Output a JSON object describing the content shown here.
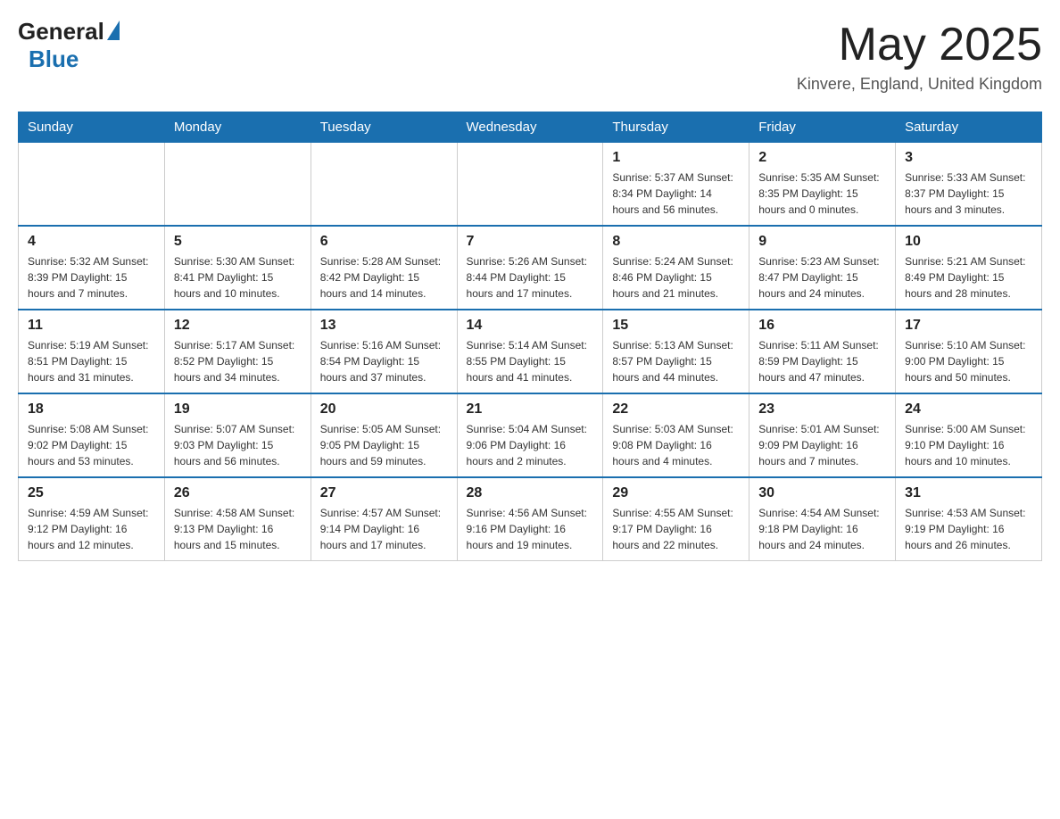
{
  "header": {
    "logo_general": "General",
    "logo_blue": "Blue",
    "month_title": "May 2025",
    "location": "Kinvere, England, United Kingdom"
  },
  "days_of_week": [
    "Sunday",
    "Monday",
    "Tuesday",
    "Wednesday",
    "Thursday",
    "Friday",
    "Saturday"
  ],
  "weeks": [
    [
      {
        "day": "",
        "info": ""
      },
      {
        "day": "",
        "info": ""
      },
      {
        "day": "",
        "info": ""
      },
      {
        "day": "",
        "info": ""
      },
      {
        "day": "1",
        "info": "Sunrise: 5:37 AM\nSunset: 8:34 PM\nDaylight: 14 hours\nand 56 minutes."
      },
      {
        "day": "2",
        "info": "Sunrise: 5:35 AM\nSunset: 8:35 PM\nDaylight: 15 hours\nand 0 minutes."
      },
      {
        "day": "3",
        "info": "Sunrise: 5:33 AM\nSunset: 8:37 PM\nDaylight: 15 hours\nand 3 minutes."
      }
    ],
    [
      {
        "day": "4",
        "info": "Sunrise: 5:32 AM\nSunset: 8:39 PM\nDaylight: 15 hours\nand 7 minutes."
      },
      {
        "day": "5",
        "info": "Sunrise: 5:30 AM\nSunset: 8:41 PM\nDaylight: 15 hours\nand 10 minutes."
      },
      {
        "day": "6",
        "info": "Sunrise: 5:28 AM\nSunset: 8:42 PM\nDaylight: 15 hours\nand 14 minutes."
      },
      {
        "day": "7",
        "info": "Sunrise: 5:26 AM\nSunset: 8:44 PM\nDaylight: 15 hours\nand 17 minutes."
      },
      {
        "day": "8",
        "info": "Sunrise: 5:24 AM\nSunset: 8:46 PM\nDaylight: 15 hours\nand 21 minutes."
      },
      {
        "day": "9",
        "info": "Sunrise: 5:23 AM\nSunset: 8:47 PM\nDaylight: 15 hours\nand 24 minutes."
      },
      {
        "day": "10",
        "info": "Sunrise: 5:21 AM\nSunset: 8:49 PM\nDaylight: 15 hours\nand 28 minutes."
      }
    ],
    [
      {
        "day": "11",
        "info": "Sunrise: 5:19 AM\nSunset: 8:51 PM\nDaylight: 15 hours\nand 31 minutes."
      },
      {
        "day": "12",
        "info": "Sunrise: 5:17 AM\nSunset: 8:52 PM\nDaylight: 15 hours\nand 34 minutes."
      },
      {
        "day": "13",
        "info": "Sunrise: 5:16 AM\nSunset: 8:54 PM\nDaylight: 15 hours\nand 37 minutes."
      },
      {
        "day": "14",
        "info": "Sunrise: 5:14 AM\nSunset: 8:55 PM\nDaylight: 15 hours\nand 41 minutes."
      },
      {
        "day": "15",
        "info": "Sunrise: 5:13 AM\nSunset: 8:57 PM\nDaylight: 15 hours\nand 44 minutes."
      },
      {
        "day": "16",
        "info": "Sunrise: 5:11 AM\nSunset: 8:59 PM\nDaylight: 15 hours\nand 47 minutes."
      },
      {
        "day": "17",
        "info": "Sunrise: 5:10 AM\nSunset: 9:00 PM\nDaylight: 15 hours\nand 50 minutes."
      }
    ],
    [
      {
        "day": "18",
        "info": "Sunrise: 5:08 AM\nSunset: 9:02 PM\nDaylight: 15 hours\nand 53 minutes."
      },
      {
        "day": "19",
        "info": "Sunrise: 5:07 AM\nSunset: 9:03 PM\nDaylight: 15 hours\nand 56 minutes."
      },
      {
        "day": "20",
        "info": "Sunrise: 5:05 AM\nSunset: 9:05 PM\nDaylight: 15 hours\nand 59 minutes."
      },
      {
        "day": "21",
        "info": "Sunrise: 5:04 AM\nSunset: 9:06 PM\nDaylight: 16 hours\nand 2 minutes."
      },
      {
        "day": "22",
        "info": "Sunrise: 5:03 AM\nSunset: 9:08 PM\nDaylight: 16 hours\nand 4 minutes."
      },
      {
        "day": "23",
        "info": "Sunrise: 5:01 AM\nSunset: 9:09 PM\nDaylight: 16 hours\nand 7 minutes."
      },
      {
        "day": "24",
        "info": "Sunrise: 5:00 AM\nSunset: 9:10 PM\nDaylight: 16 hours\nand 10 minutes."
      }
    ],
    [
      {
        "day": "25",
        "info": "Sunrise: 4:59 AM\nSunset: 9:12 PM\nDaylight: 16 hours\nand 12 minutes."
      },
      {
        "day": "26",
        "info": "Sunrise: 4:58 AM\nSunset: 9:13 PM\nDaylight: 16 hours\nand 15 minutes."
      },
      {
        "day": "27",
        "info": "Sunrise: 4:57 AM\nSunset: 9:14 PM\nDaylight: 16 hours\nand 17 minutes."
      },
      {
        "day": "28",
        "info": "Sunrise: 4:56 AM\nSunset: 9:16 PM\nDaylight: 16 hours\nand 19 minutes."
      },
      {
        "day": "29",
        "info": "Sunrise: 4:55 AM\nSunset: 9:17 PM\nDaylight: 16 hours\nand 22 minutes."
      },
      {
        "day": "30",
        "info": "Sunrise: 4:54 AM\nSunset: 9:18 PM\nDaylight: 16 hours\nand 24 minutes."
      },
      {
        "day": "31",
        "info": "Sunrise: 4:53 AM\nSunset: 9:19 PM\nDaylight: 16 hours\nand 26 minutes."
      }
    ]
  ]
}
